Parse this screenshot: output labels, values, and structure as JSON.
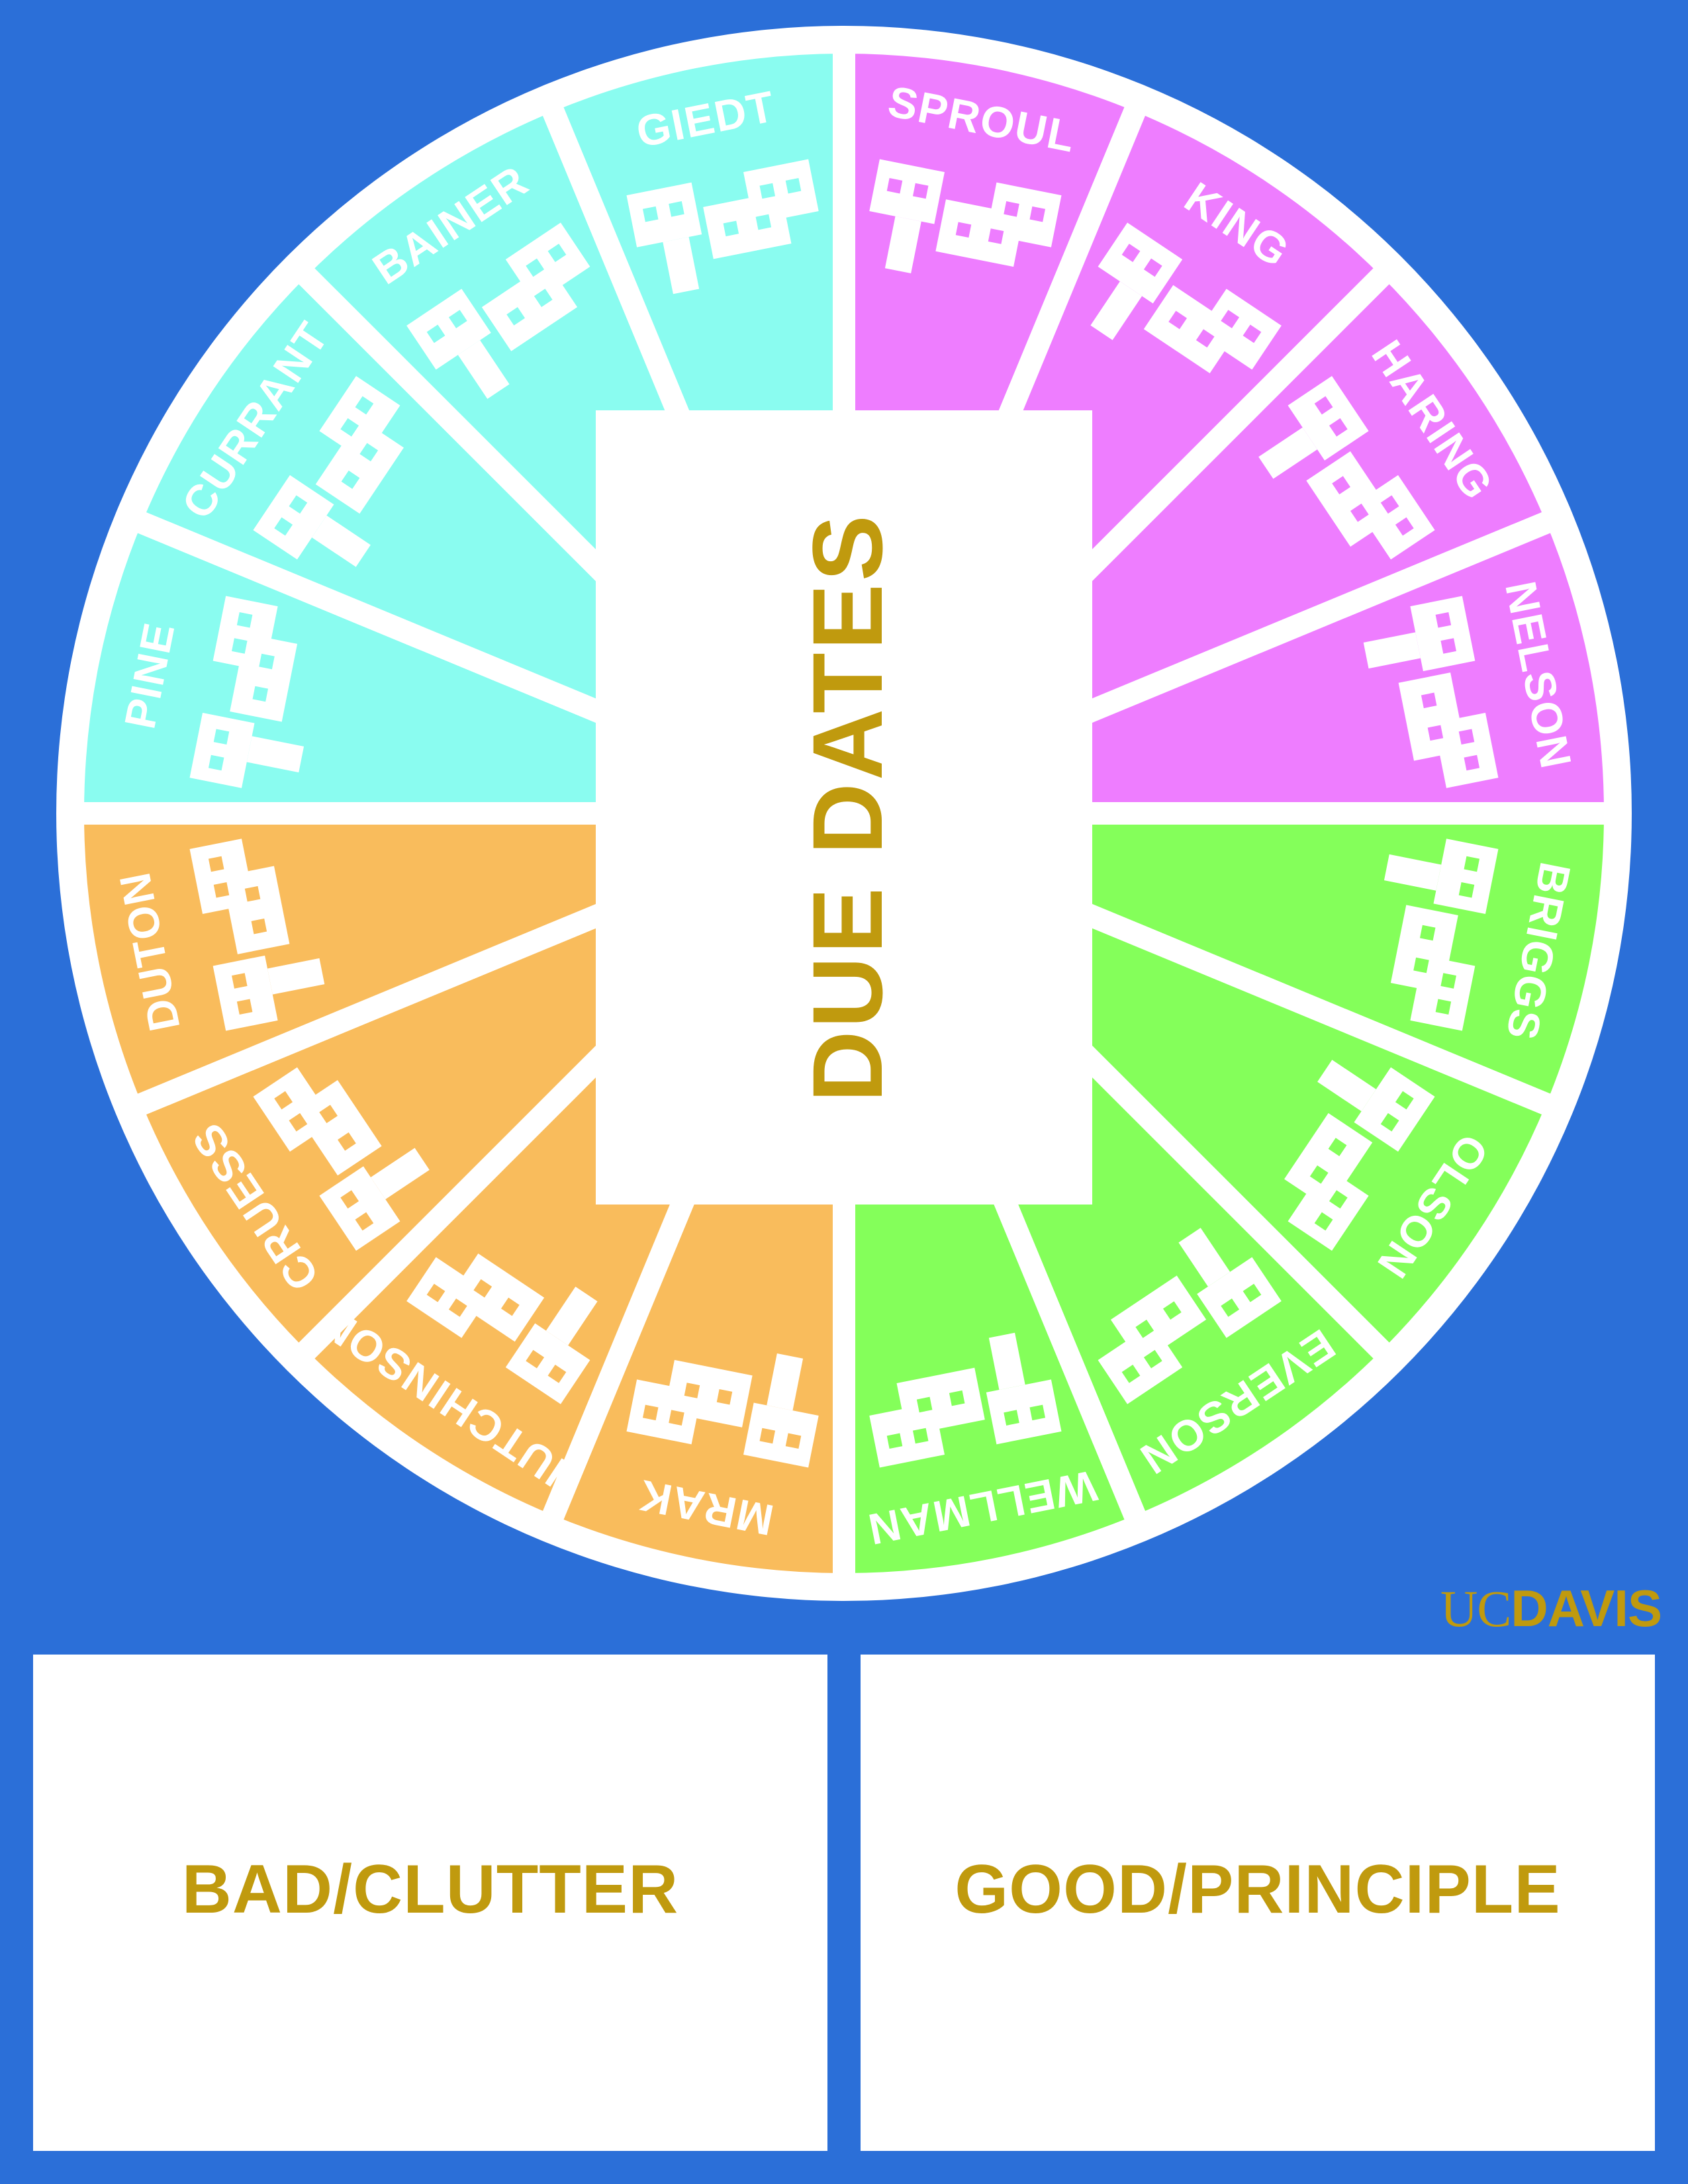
{
  "center": {
    "title": "DUE DATES",
    "title_color": "#c09a0e"
  },
  "groups": [
    {
      "color": "#ee7dff",
      "halls": [
        "SPROUL",
        "KING",
        "HARING",
        "NELSON"
      ]
    },
    {
      "color": "#84ff5a",
      "halls": [
        "BRIGGS",
        "OLSON",
        "EVERSON",
        "WELLMAN"
      ]
    },
    {
      "color": "#f9bc5c",
      "halls": [
        "MRAK",
        "HUTCHINSON",
        "CRUESS",
        "DUTON"
      ]
    },
    {
      "color": "#8afcf0",
      "halls": [
        "PINE",
        "CURRANT",
        "BAINER",
        "GIEDT"
      ]
    }
  ],
  "colors": {
    "background": "#2b6fd8",
    "ring": "#ffffff",
    "accent_gold": "#c09a0e"
  },
  "icons": {
    "building": "building-icon"
  },
  "logo": {
    "uc": "UC",
    "davis": "DAVIS",
    "color": "#c09a0e"
  },
  "boxes": {
    "bad_label": "BAD/CLUTTER",
    "good_label": "GOOD/PRINCIPLE",
    "label_color": "#c09a0e"
  }
}
